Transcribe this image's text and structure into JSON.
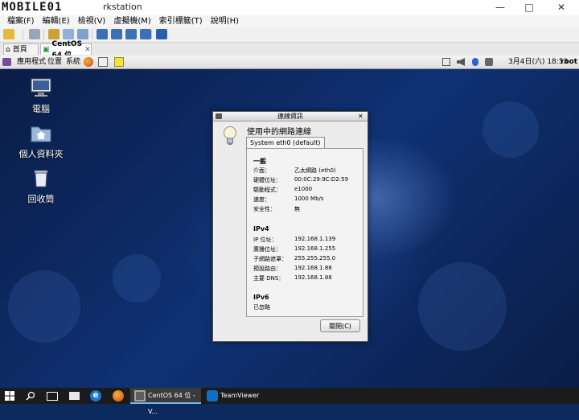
{
  "window": {
    "logo_text": "MOBILE01",
    "title": "rkstation",
    "controls": {
      "minimize": "—",
      "maximize": "□",
      "close": "✕"
    }
  },
  "menubar": {
    "items": [
      "檔案(F)",
      "編輯(E)",
      "檢視(V)",
      "虛擬機(M)",
      "索引標籤(T)",
      "說明(H)"
    ]
  },
  "tabs": [
    {
      "label": "首頁",
      "icon": "home-icon"
    },
    {
      "label": "CentOS 64 位",
      "icon": "vm-icon",
      "active": true,
      "close": "✕"
    }
  ],
  "gnome_panel": {
    "applications": "應用程式",
    "places": "位置",
    "system": "系統",
    "clock": "3月4日(六) 18:53",
    "user": "root"
  },
  "desktop_icons": [
    {
      "label": "電腦",
      "icon": "computer-icon"
    },
    {
      "label": "個人資料夾",
      "icon": "home-folder-icon"
    },
    {
      "label": "回收筒",
      "icon": "trash-icon"
    }
  ],
  "dialog": {
    "title": "連線資訊",
    "close": "✕",
    "heading": "使用中的網路連線",
    "tab": "System eth0 (default)",
    "general": {
      "title": "一般",
      "rows": [
        {
          "key": "介面：",
          "value": "乙太網路 (eth0)"
        },
        {
          "key": "硬體位址：",
          "value": "00:0C:29:9C:D2:59"
        },
        {
          "key": "驅動程式：",
          "value": "e1000"
        },
        {
          "key": "速度：",
          "value": "1000 Mb/s"
        },
        {
          "key": "安全性：",
          "value": "無"
        }
      ]
    },
    "ipv4": {
      "title": "IPv4",
      "rows": [
        {
          "key": "IP 位址：",
          "value": "192.168.1.139"
        },
        {
          "key": "廣播位址：",
          "value": "192.168.1.255"
        },
        {
          "key": "子網路遮罩：",
          "value": "255.255.255.0"
        },
        {
          "key": "預設路由：",
          "value": "192.168.1.88"
        },
        {
          "key": "主要 DNS：",
          "value": "192.168.1.88"
        }
      ]
    },
    "ipv6": {
      "title": "IPv6",
      "value": "已忽略"
    },
    "close_button": "關閉(C)"
  },
  "taskbar": {
    "items": [
      {
        "label": "CentOS 64 位 - V...",
        "icon": "vmware-icon",
        "active": true
      },
      {
        "label": "TeamViewer",
        "icon": "teamviewer-icon"
      }
    ]
  },
  "colors": {
    "desktop_bg": "#0f3173",
    "taskbar_bg": "#1b1b1b",
    "dialog_bg": "#ececec"
  }
}
